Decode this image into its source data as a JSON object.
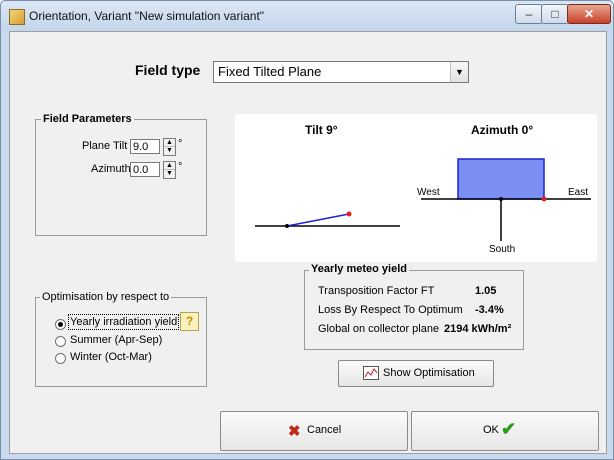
{
  "window": {
    "title": "Orientation, Variant \"New simulation variant\"",
    "controls": {
      "minimize": "‒",
      "maximize": "□",
      "close": "✕"
    }
  },
  "field_type": {
    "label": "Field type",
    "value": "Fixed Tilted Plane"
  },
  "field_parameters": {
    "title": "Field Parameters",
    "tilt": {
      "label": "Plane Tilt",
      "value": "9.0",
      "unit": "°"
    },
    "azimuth": {
      "label": "Azimuth",
      "value": "0.0",
      "unit": "°"
    }
  },
  "diagram": {
    "tilt_label": "Tilt 9°",
    "azimuth_label": "Azimuth 0°",
    "west": "West",
    "east": "East",
    "south": "South"
  },
  "optimisation": {
    "title": "Optimisation by respect to",
    "help": "?",
    "options": [
      {
        "label": "Yearly irradiation yield",
        "selected": true
      },
      {
        "label": "Summer (Apr-Sep)",
        "selected": false
      },
      {
        "label": "Winter (Oct-Mar)",
        "selected": false
      }
    ]
  },
  "meteo": {
    "title": "Yearly meteo yield",
    "rows": [
      {
        "label": "Transposition Factor FT",
        "value": "1.05"
      },
      {
        "label": "Loss By Respect To Optimum",
        "value": "-3.4%"
      },
      {
        "label": "Global on collector plane",
        "value": "2194 kWh/m²"
      }
    ]
  },
  "buttons": {
    "show_optimisation": "Show Optimisation",
    "cancel": "Cancel",
    "ok": "OK"
  },
  "colors": {
    "plane_fill": "#7b8ef2",
    "tilt_line": "#1d22d6",
    "marker": "#e02020",
    "ok_check": "#2a9a1a",
    "cancel_x": "#c0281c"
  }
}
